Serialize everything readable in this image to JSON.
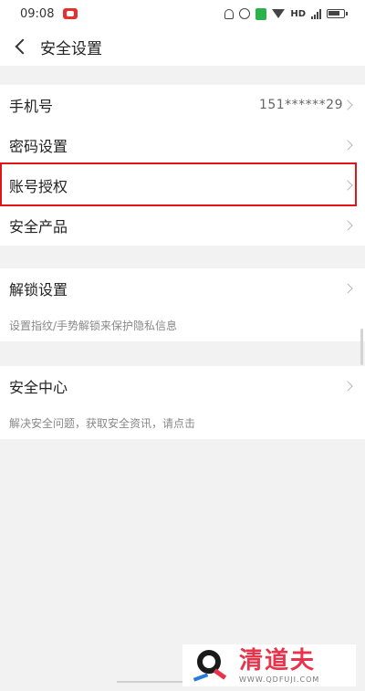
{
  "status_bar": {
    "time": "09:08",
    "network": "HD"
  },
  "header": {
    "title": "安全设置"
  },
  "group1": {
    "rows": [
      {
        "label": "手机号",
        "value": "151******29"
      },
      {
        "label": "密码设置"
      },
      {
        "label": "账号授权"
      },
      {
        "label": "安全产品"
      }
    ]
  },
  "group2": {
    "label": "解锁设置",
    "hint": "设置指纹/手势解锁来保护隐私信息"
  },
  "group3": {
    "label": "安全中心",
    "hint": "解决安全问题，获取安全资讯，请点击"
  },
  "watermark": {
    "brand": "清道夫",
    "url": "WWW.QDFUJI.COM"
  },
  "colors": {
    "highlight": "#e01515",
    "brand": "#e8334a"
  }
}
